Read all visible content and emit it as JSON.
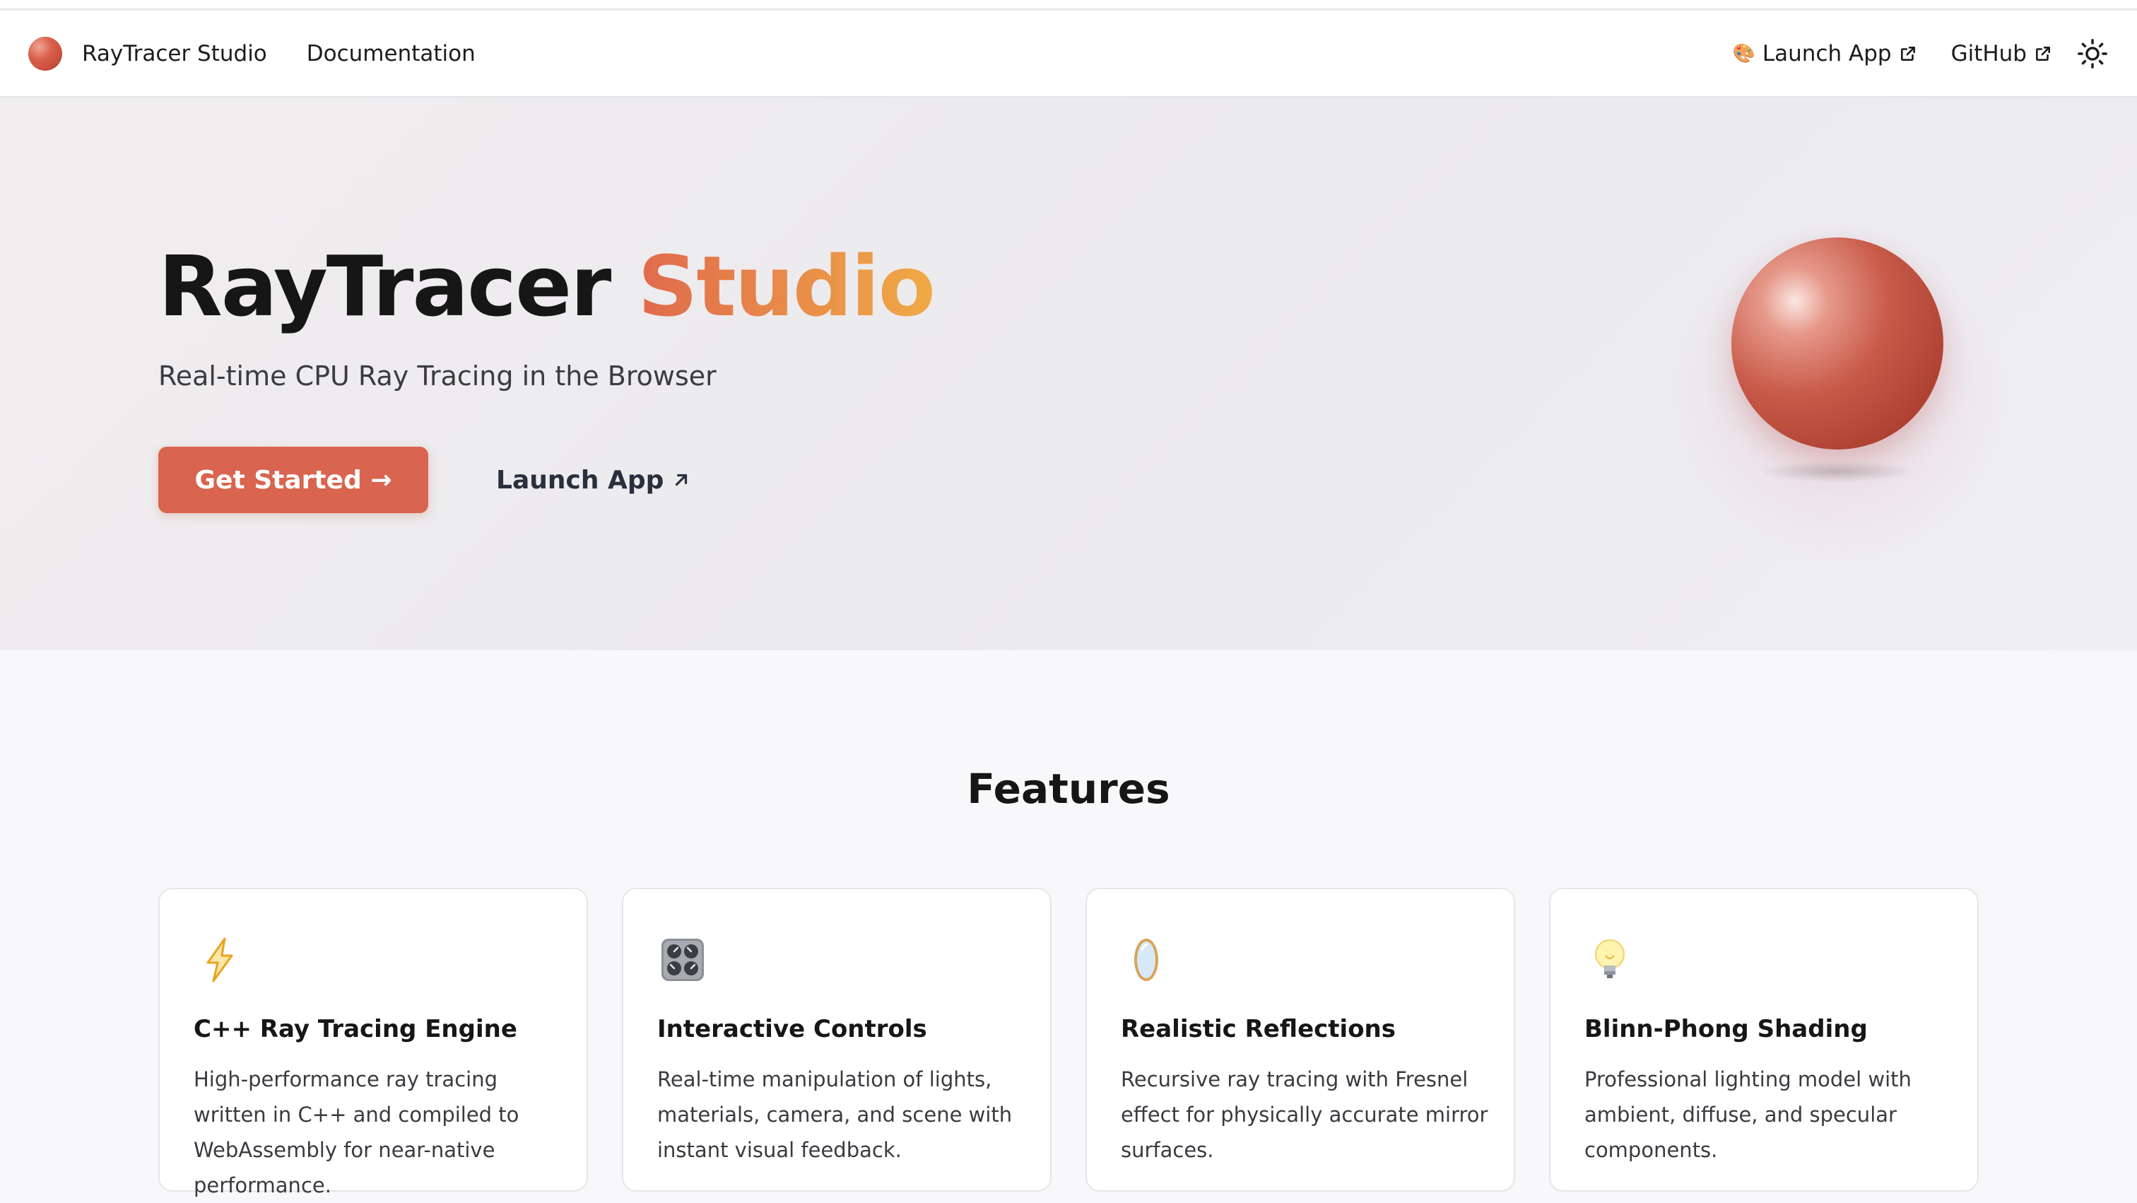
{
  "nav": {
    "brand": "RayTracer Studio",
    "documentation": "Documentation",
    "launch_app": "Launch App",
    "github": "GitHub",
    "icons": {
      "logo": "red-sphere-logo-icon",
      "palette": "palette-icon",
      "external": "external-link-icon",
      "theme": "sun-icon"
    }
  },
  "hero": {
    "title_main": "RayTracer",
    "title_accent": "Studio",
    "subtitle": "Real-time CPU Ray Tracing in the Browser",
    "primary_button": "Get Started →",
    "secondary_button": "Launch App",
    "colors": {
      "primary_button": "#d9644f",
      "accent_start": "#e06a4d",
      "accent_end": "#f0aa45"
    }
  },
  "features": {
    "title": "Features",
    "cards": [
      {
        "icon": "lightning-icon",
        "title": "C++ Ray Tracing Engine",
        "description": "High-performance ray tracing written in C++ and compiled to WebAssembly for near-native performance."
      },
      {
        "icon": "control-knobs-icon",
        "title": "Interactive Controls",
        "description": "Real-time manipulation of lights, materials, camera, and scene with instant visual feedback."
      },
      {
        "icon": "mirror-icon",
        "title": "Realistic Reflections",
        "description": "Recursive ray tracing with Fresnel effect for physically accurate mirror surfaces."
      },
      {
        "icon": "light-bulb-icon",
        "title": "Blinn-Phong Shading",
        "description": "Professional lighting model with ambient, diffuse, and specular components."
      }
    ]
  }
}
